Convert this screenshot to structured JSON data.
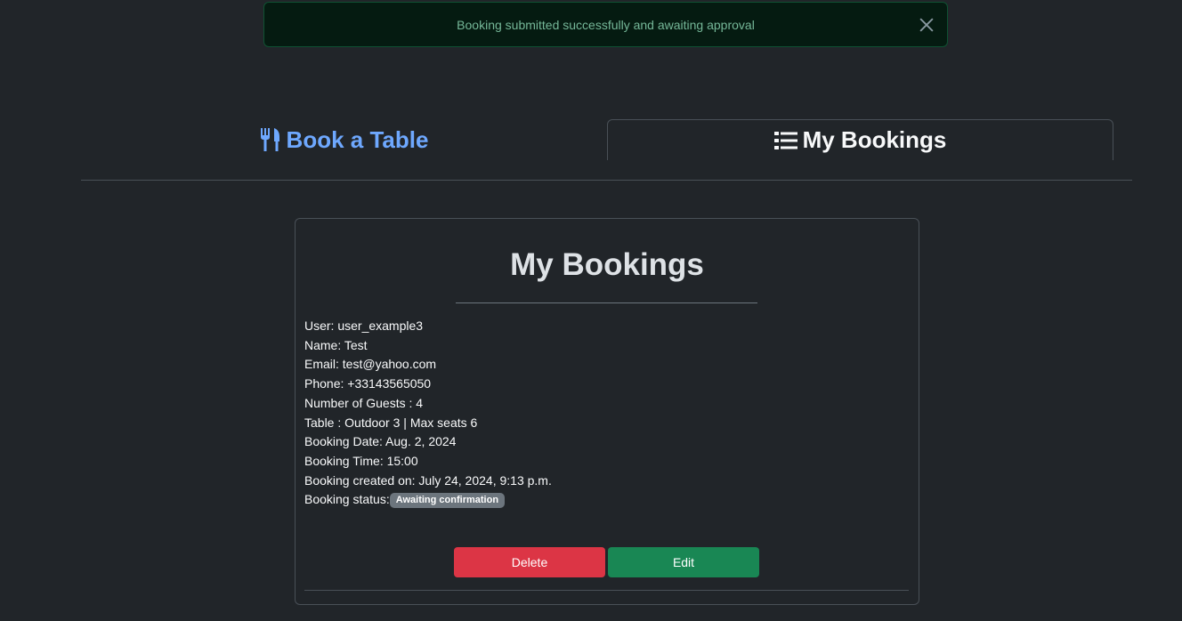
{
  "alert": {
    "message": "Booking submitted successfully and awaiting approval",
    "close_icon": "close-icon"
  },
  "tabs": {
    "book": {
      "label": "Book a Table",
      "icon": "utensils-icon",
      "color": "#6ea8fe"
    },
    "my_bookings": {
      "label": "My Bookings",
      "icon": "list-icon",
      "active": true
    }
  },
  "card": {
    "title": "My Bookings",
    "details": [
      "User: user_example3",
      "Name: Test",
      "Email: test@yahoo.com",
      "Phone: +33143565050",
      "Number of Guests : 4",
      "Table : Outdoor 3 | Max seats 6",
      "Booking Date: Aug. 2, 2024",
      "Booking Time: 15:00",
      "Booking created on: July 24, 2024, 9:13 p.m."
    ],
    "status_label": "Booking status:",
    "status_badge": "Awaiting confirmation",
    "delete_label": "Delete",
    "edit_label": "Edit"
  },
  "colors": {
    "background": "#212529",
    "alert_bg": "#051b11",
    "alert_text": "#75b798",
    "delete": "#dc3545",
    "edit": "#198754",
    "badge": "#6c757d"
  }
}
